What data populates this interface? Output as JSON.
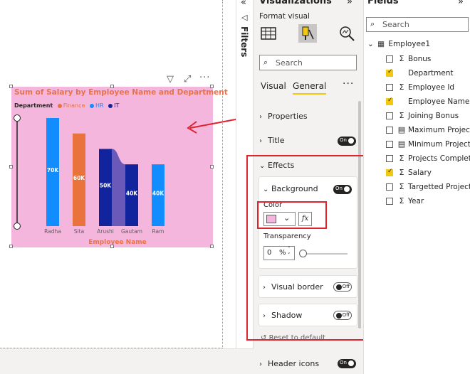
{
  "visual": {
    "title": "Sum of Salary by Employee Name and Department",
    "legend_title": "Department",
    "legend": [
      {
        "label": "Finance",
        "color": "#e8733c"
      },
      {
        "label": "HR",
        "color": "#118dff"
      },
      {
        "label": "IT",
        "color": "#12239e"
      }
    ],
    "toolbar_icons": [
      "filter-icon",
      "focus-mode-icon",
      "more-options-icon"
    ]
  },
  "chart_data": {
    "type": "bar",
    "xlabel": "Employee Name",
    "ylabel": "",
    "categories": [
      "Radha",
      "Sita",
      "Arushi",
      "Gautam",
      "Ram"
    ],
    "values": [
      70,
      60,
      50,
      40,
      40
    ],
    "data_labels": [
      "70K",
      "60K",
      "50K",
      "40K",
      "40K"
    ],
    "category_department": [
      "HR",
      "Finance",
      "IT",
      "IT",
      "HR"
    ],
    "ylim": [
      0,
      70
    ],
    "grid": false,
    "legend_position": "top-left"
  },
  "filters": {
    "label": "Filters",
    "collapse_icon": "chevron-double-left-icon"
  },
  "viz": {
    "title": "Visualizations",
    "format_visual_label": "Format visual",
    "search_placeholder": "Search",
    "tabs": [
      "Visual",
      "General"
    ],
    "active_tab": "General",
    "sections": {
      "properties": "Properties",
      "title": "Title",
      "title_toggle": "On",
      "effects": "Effects",
      "background": "Background",
      "background_toggle": "On",
      "color_label": "Color",
      "color_value": "#f4b6dd",
      "fx_label": "fx",
      "transparency_label": "Transparency",
      "transparency_value": "0",
      "transparency_unit": "%",
      "transparency_level": 0,
      "visual_border": "Visual border",
      "visual_border_toggle": "Off",
      "shadow": "Shadow",
      "shadow_toggle": "Off",
      "reset": "Reset to default",
      "header_icons": "Header icons",
      "header_icons_toggle": "On"
    }
  },
  "fields": {
    "title": "Fields",
    "search_placeholder": "Search",
    "table": "Employee1",
    "items": [
      {
        "name": "Bonus",
        "checked": false,
        "icon": "sigma"
      },
      {
        "name": "Department",
        "checked": true,
        "icon": "none"
      },
      {
        "name": "Employee Id",
        "checked": false,
        "icon": "sigma"
      },
      {
        "name": "Employee Name",
        "checked": true,
        "icon": "none"
      },
      {
        "name": "Joining Bonus",
        "checked": false,
        "icon": "sigma"
      },
      {
        "name": "Maximum Projects",
        "checked": false,
        "icon": "calculator"
      },
      {
        "name": "Minimum Projects",
        "checked": false,
        "icon": "calculator"
      },
      {
        "name": "Projects Complet...",
        "checked": false,
        "icon": "sigma"
      },
      {
        "name": "Salary",
        "checked": true,
        "icon": "sigma"
      },
      {
        "name": "Targetted Projects",
        "checked": false,
        "icon": "sigma"
      },
      {
        "name": "Year",
        "checked": false,
        "icon": "sigma"
      }
    ]
  }
}
